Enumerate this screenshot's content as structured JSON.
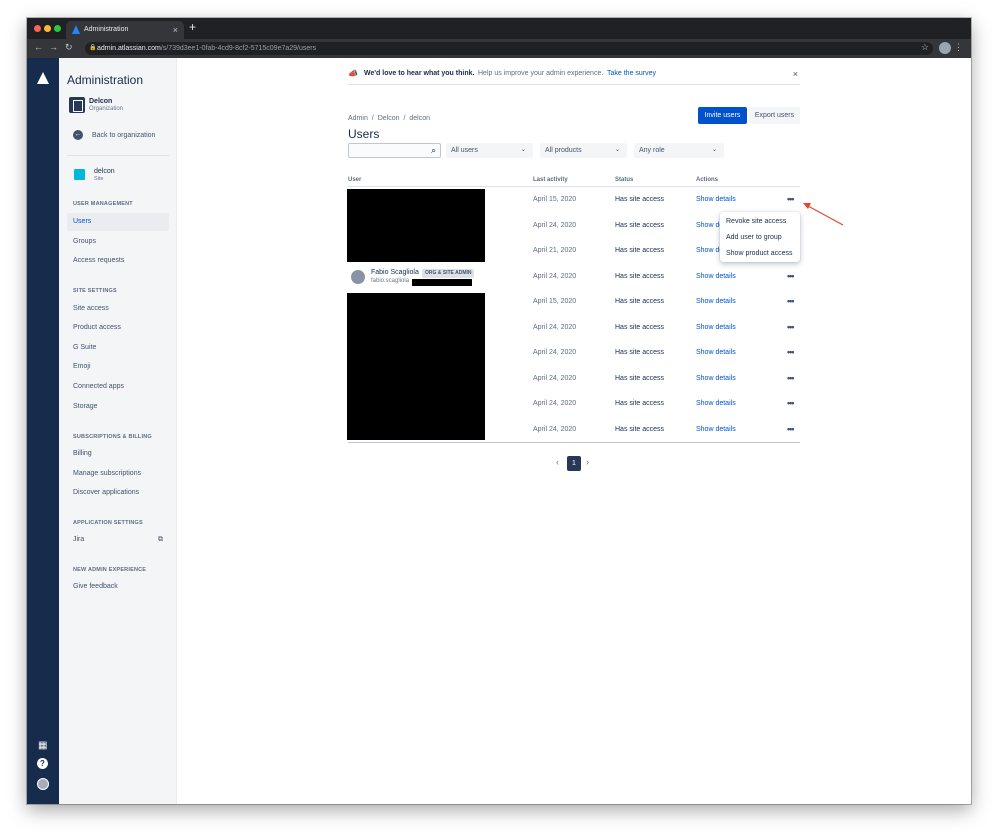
{
  "browser": {
    "tab_title": "Administration",
    "tab_close": "×",
    "new_tab": "+",
    "url_host": "admin.atlassian.com",
    "url_path": "/s/739d3ee1-0fab-4cd9-8cf2-5715c09e7a29/users"
  },
  "sidebar": {
    "title": "Administration",
    "org_name": "Delcon",
    "org_type": "Organization",
    "back_label": "Back to organization",
    "site_name": "delcon",
    "site_type": "Site",
    "sections": [
      {
        "heading": "USER MANAGEMENT",
        "items": [
          "Users",
          "Groups",
          "Access requests"
        ]
      },
      {
        "heading": "SITE SETTINGS",
        "items": [
          "Site access",
          "Product access",
          "G Suite",
          "Emoji",
          "Connected apps",
          "Storage"
        ]
      },
      {
        "heading": "SUBSCRIPTIONS & BILLING",
        "items": [
          "Billing",
          "Manage subscriptions",
          "Discover applications"
        ]
      },
      {
        "heading": "APPLICATION SETTINGS",
        "items": [
          "Jira"
        ]
      },
      {
        "heading": "NEW ADMIN EXPERIENCE",
        "items": [
          "Give feedback"
        ]
      }
    ],
    "active_item": "Users"
  },
  "banner": {
    "strong": "We'd love to hear what you think.",
    "sub": "Help us improve your admin experience.",
    "link": "Take the survey"
  },
  "breadcrumb": [
    "Admin",
    "/",
    "Delcon",
    "/",
    "delcon"
  ],
  "page_title": "Users",
  "actions": {
    "invite": "Invite users",
    "export": "Export users"
  },
  "filters": {
    "search_placeholder": "",
    "users": "All users",
    "products": "All products",
    "role": "Any role"
  },
  "table": {
    "headers": [
      "User",
      "Last activity",
      "Status",
      "Actions"
    ],
    "rows": [
      {
        "date": "April 15, 2020",
        "status": "Has site access",
        "action": "Show details"
      },
      {
        "date": "April 24, 2020",
        "status": "Has site access",
        "action": "Show details"
      },
      {
        "date": "April 21, 2020",
        "status": "Has site access",
        "action": "Show details"
      },
      {
        "date": "April 24, 2020",
        "status": "Has site access",
        "action": "Show details"
      },
      {
        "date": "April 15, 2020",
        "status": "Has site access",
        "action": "Show details"
      },
      {
        "date": "April 24, 2020",
        "status": "Has site access",
        "action": "Show details"
      },
      {
        "date": "April 24, 2020",
        "status": "Has site access",
        "action": "Show details"
      },
      {
        "date": "April 24, 2020",
        "status": "Has site access",
        "action": "Show details"
      },
      {
        "date": "April 24, 2020",
        "status": "Has site access",
        "action": "Show details"
      },
      {
        "date": "April 24, 2020",
        "status": "Has site access",
        "action": "Show details"
      }
    ],
    "visible_user": {
      "name": "Fabio Scagliola",
      "badge": "ORG & SITE ADMIN",
      "email": "fabio.scagliola"
    },
    "more_glyph": "•••"
  },
  "row_menu": [
    "Revoke site access",
    "Add user to group",
    "Show product access"
  ],
  "pagination": {
    "prev": "‹",
    "current": "1",
    "next": "›"
  },
  "colors": {
    "primary": "#0052cc",
    "nav": "#172b4d",
    "annotation_arrow": "#e8452c"
  }
}
